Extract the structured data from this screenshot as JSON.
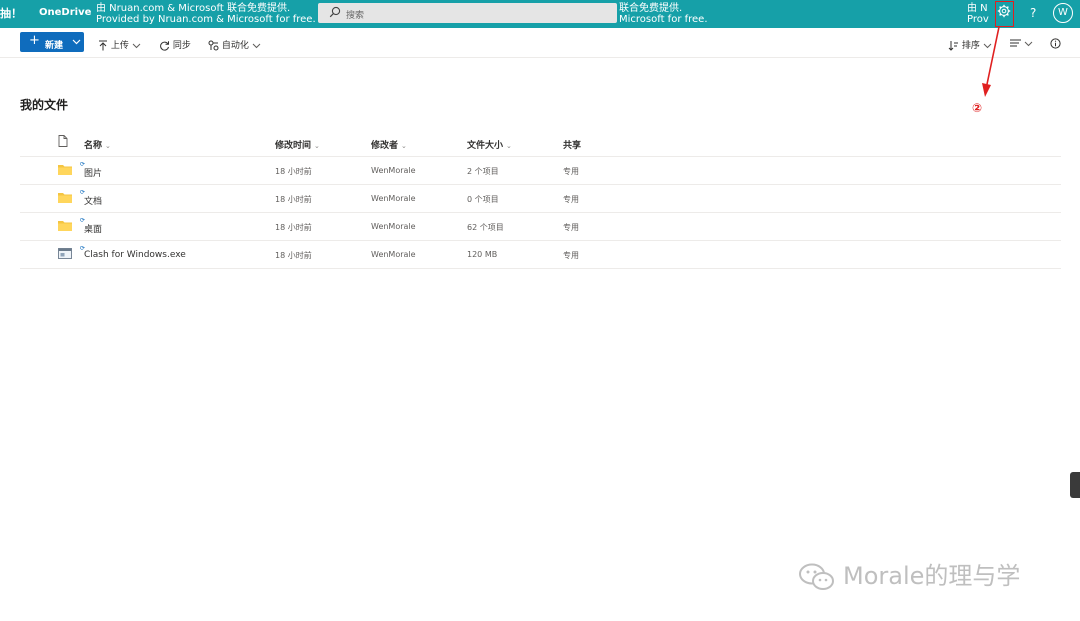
{
  "topbar": {
    "edge_text": "抽！",
    "app_name": "OneDrive",
    "banner_left": [
      "由 Nruan.com & Microsoft 联合免费提供.",
      "Provided by Nruan.com & Microsoft for free."
    ],
    "banner_mid": [
      "联合免费提供.",
      "Microsoft for free."
    ],
    "banner_right": [
      "由 N",
      "Prov"
    ],
    "search_placeholder": "搜索",
    "help": "?",
    "avatar": "W",
    "color": "#16a0a8"
  },
  "commandbar": {
    "new": "新建",
    "upload": "上传",
    "sync": "同步",
    "automate": "自动化",
    "sort": "排序"
  },
  "page_title": "我的文件",
  "table": {
    "columns": [
      "名称",
      "修改时间",
      "修改者",
      "文件大小",
      "共享"
    ],
    "rows": [
      {
        "icon": "folder-icon",
        "name": "图片",
        "modified": "18 小时前",
        "by": "WenMorale",
        "size": "2 个项目",
        "sharing": "专用"
      },
      {
        "icon": "folder-icon",
        "name": "文档",
        "modified": "18 小时前",
        "by": "WenMorale",
        "size": "0 个项目",
        "sharing": "专用"
      },
      {
        "icon": "folder-icon",
        "name": "桌面",
        "modified": "18 小时前",
        "by": "WenMorale",
        "size": "62 个项目",
        "sharing": "专用"
      },
      {
        "icon": "exe-file-icon",
        "name": "Clash for Windows.exe",
        "modified": "18 小时前",
        "by": "WenMorale",
        "size": "120 MB",
        "sharing": "专用"
      }
    ]
  },
  "annotation": {
    "number": "②",
    "color": "#e02020"
  },
  "watermark": "Morale的理与学"
}
